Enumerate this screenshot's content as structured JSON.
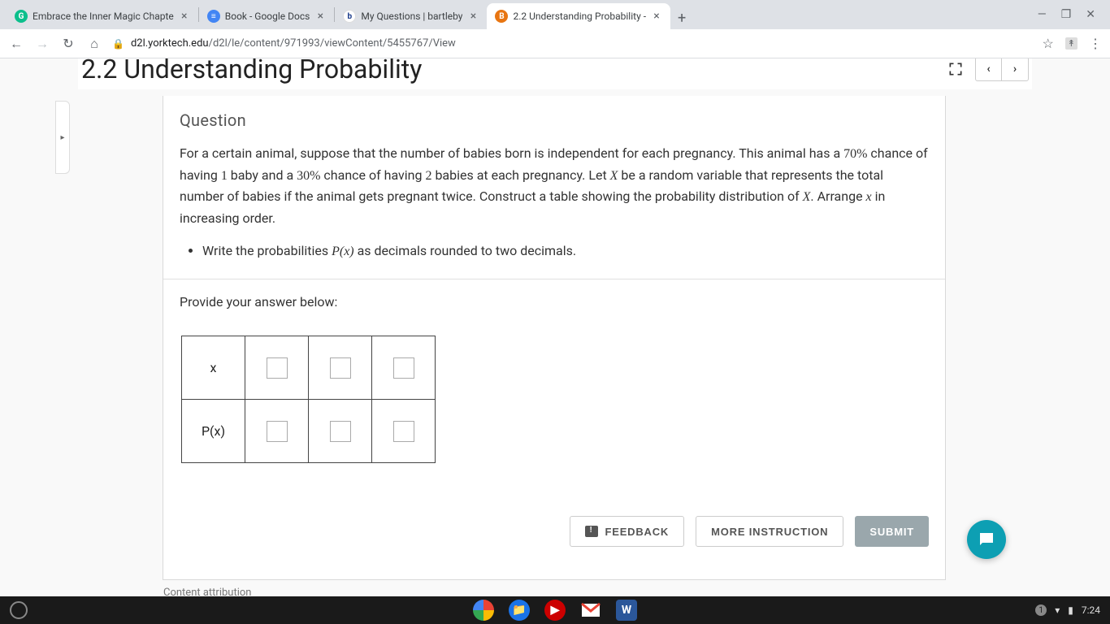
{
  "browser": {
    "tabs": [
      {
        "title": "Embrace the Inner Magic Chapte",
        "favicon_bg": "#0bbf8c",
        "favicon_txt": "G",
        "favicon_color": "#fff"
      },
      {
        "title": "Book - Google Docs",
        "favicon_bg": "#4285f4",
        "favicon_txt": "≡",
        "favicon_color": "#fff"
      },
      {
        "title": "My Questions | bartleby",
        "favicon_bg": "#fff",
        "favicon_txt": "b",
        "favicon_color": "#1a3b8b"
      },
      {
        "title": "2.2 Understanding Probability - ",
        "favicon_bg": "#e87511",
        "favicon_txt": "B",
        "favicon_color": "#fff",
        "active": true
      }
    ],
    "url_domain": "d2l.yorktech.edu",
    "url_path": "/d2l/le/content/971993/viewContent/5455767/View"
  },
  "page": {
    "title": "2.2 Understanding Probability",
    "question_label": "Question",
    "question_text_1": "For a certain animal, suppose that the number of babies born is independent for each pregnancy. This animal has a ",
    "question_pct1": "70%",
    "question_text_2": " chance of having ",
    "question_n1": "1",
    "question_text_3": " baby and a ",
    "question_pct2": "30%",
    "question_text_4": " chance of having ",
    "question_n2": "2",
    "question_text_5": " babies at each pregnancy. Let ",
    "question_X": "X",
    "question_text_6": " be a random variable that represents the total number of babies if the animal gets pregnant twice. Construct a table showing the probability distribution of ",
    "question_X2": "X",
    "question_text_7": ". Arrange ",
    "question_x_lc": "x",
    "question_text_8": " in increasing order.",
    "bullet_1a": "Write the probabilities ",
    "bullet_px": "P(x)",
    "bullet_1b": " as decimals rounded to two decimals.",
    "answer_label": "Provide your answer below:",
    "row1_header": "x",
    "row2_header": "P(x)",
    "feedback_label": "FEEDBACK",
    "more_label": "MORE INSTRUCTION",
    "submit_label": "SUBMIT",
    "attribution": "Content attribution"
  },
  "taskbar": {
    "time": "7:24",
    "notif": "1"
  }
}
